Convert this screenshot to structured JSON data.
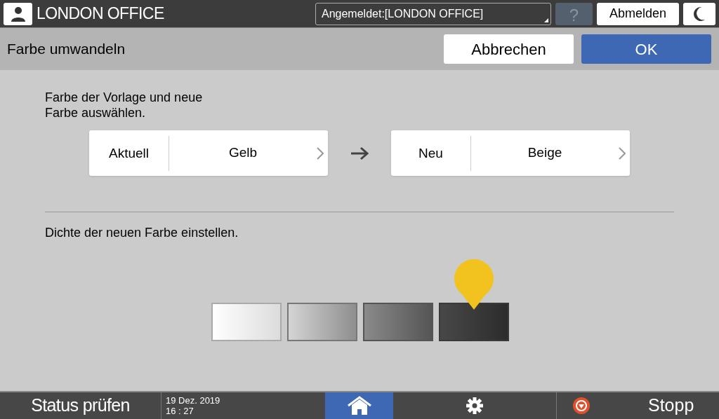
{
  "header": {
    "user": "LONDON OFFICE",
    "login_status": "Angemeldet:[LONDON OFFICE]",
    "help": {
      "label": "?",
      "disabled": true
    },
    "logout": "Abmelden"
  },
  "title_bar": {
    "title": "Farbe umwandeln",
    "buttons": [
      {
        "label": "Abbrechen",
        "kind": "secondary"
      },
      {
        "label": "OK",
        "kind": "primary"
      }
    ]
  },
  "instruction": "Farbe der Vorlage und neue\nFarbe auswählen.",
  "selectors": [
    {
      "label": "Aktuell",
      "value": "Gelb"
    },
    {
      "label": "Neu",
      "value": "Beige"
    }
  ],
  "density": {
    "label": "Dichte der neuen Farbe einstellen.",
    "swatches": [
      {
        "selected": false
      },
      {
        "selected": false
      },
      {
        "selected": false
      },
      {
        "selected": true
      }
    ]
  },
  "footer": {
    "status": "Status prüfen",
    "date": "19 Dez. 2019",
    "time": "16 : 27",
    "stop": "Stopp"
  }
}
